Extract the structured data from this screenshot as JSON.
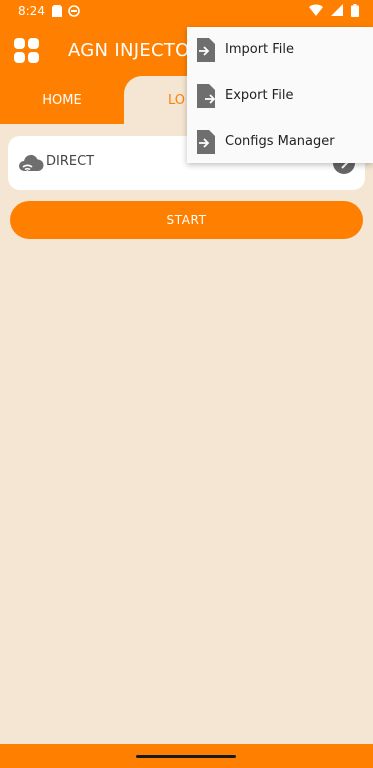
{
  "status_bar": {
    "time": "8:24"
  },
  "app": {
    "title": "AGN INJECTOR"
  },
  "tabs": [
    {
      "label": "HOME"
    },
    {
      "label": "LO"
    }
  ],
  "server": {
    "label": "DIRECT"
  },
  "start_button": {
    "label": "START"
  },
  "overflow_menu": {
    "items": [
      {
        "label": "Import File",
        "icon": "file-import-icon"
      },
      {
        "label": "Export File",
        "icon": "file-export-icon"
      },
      {
        "label": "Configs Manager",
        "icon": "file-settings-icon"
      }
    ]
  },
  "colors": {
    "accent": "#ff8000",
    "background": "#f5e6d3"
  }
}
